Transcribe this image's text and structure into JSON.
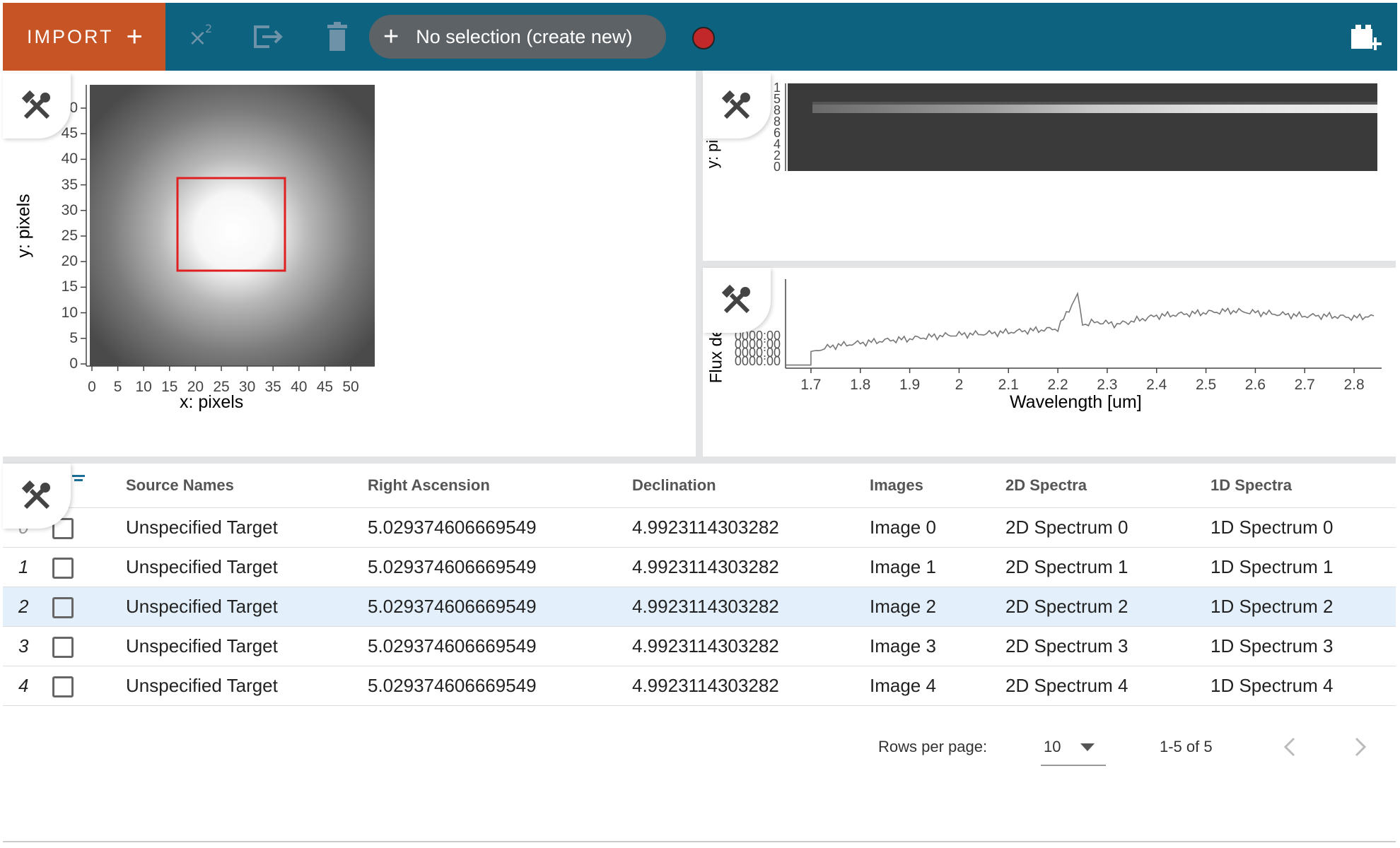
{
  "toolbar": {
    "import_label": "IMPORT",
    "import_plus": "+",
    "selection_label": "No selection (create new)",
    "selection_plus": "+",
    "chi2_icon": "x-squared-icon",
    "export_icon": "export-icon",
    "delete_icon": "trash-icon",
    "record_color": "#c0282a",
    "add_viewer_icon": "add-viewer-icon"
  },
  "colors": {
    "toolbar_bg": "#0d6280",
    "import_bg": "#c75425",
    "selection_bg": "#5d6266",
    "highlight_row": "#e3f0fb"
  },
  "image_viewer": {
    "xlabel": "x: pixels",
    "ylabel": "y: pixels",
    "x_ticks": [
      "0",
      "5",
      "10",
      "15",
      "20",
      "25",
      "30",
      "35",
      "40",
      "45",
      "50"
    ],
    "y_ticks": [
      "0",
      "5",
      "10",
      "15",
      "20",
      "25",
      "30",
      "35",
      "40",
      "45",
      "0"
    ],
    "roi_color": "#e02020"
  },
  "spectrum2d_viewer": {
    "ylabel": "y: pi",
    "y_ticks": [
      "0",
      "2",
      "4",
      "6",
      "8",
      "8",
      "5",
      "1"
    ]
  },
  "chart_data": {
    "type": "line",
    "xlabel": "Wavelength [um]",
    "ylabel": "Flux de",
    "x_ticks": [
      "1.7",
      "1.8",
      "1.9",
      "2",
      "2.1",
      "2.2",
      "2.3",
      "2.4",
      "2.5",
      "2.6",
      "2.7",
      "2.8"
    ],
    "y_ticks": [
      "0000:00",
      "0000:00",
      "0000:00",
      "0000:00"
    ],
    "xlim": [
      1.65,
      2.85
    ],
    "x": [
      1.65,
      1.7,
      1.7,
      1.75,
      1.8,
      1.85,
      1.9,
      1.95,
      2.0,
      2.05,
      2.1,
      2.15,
      2.2,
      2.24,
      2.25,
      2.28,
      2.32,
      2.36,
      2.4,
      2.45,
      2.5,
      2.55,
      2.6,
      2.65,
      2.7,
      2.75,
      2.8,
      2.84
    ],
    "y": [
      0.02,
      0.02,
      0.18,
      0.25,
      0.28,
      0.31,
      0.33,
      0.36,
      0.38,
      0.39,
      0.41,
      0.43,
      0.45,
      0.85,
      0.5,
      0.53,
      0.5,
      0.55,
      0.6,
      0.62,
      0.64,
      0.66,
      0.64,
      0.62,
      0.6,
      0.6,
      0.58,
      0.6
    ]
  },
  "table": {
    "headers": [
      "Source Names",
      "Right Ascension",
      "Declination",
      "Images",
      "2D Spectra",
      "1D Spectra"
    ],
    "rows": [
      {
        "idx": "0",
        "name": "Unspecified Target",
        "ra": "5.029374606669549",
        "dec": "4.9923114303282",
        "image": "Image 0",
        "spec2d": "2D Spectrum 0",
        "spec1d": "1D Spectrum 0"
      },
      {
        "idx": "1",
        "name": "Unspecified Target",
        "ra": "5.029374606669549",
        "dec": "4.9923114303282",
        "image": "Image 1",
        "spec2d": "2D Spectrum 1",
        "spec1d": "1D Spectrum 1"
      },
      {
        "idx": "2",
        "name": "Unspecified Target",
        "ra": "5.029374606669549",
        "dec": "4.9923114303282",
        "image": "Image 2",
        "spec2d": "2D Spectrum 2",
        "spec1d": "1D Spectrum 2"
      },
      {
        "idx": "3",
        "name": "Unspecified Target",
        "ra": "5.029374606669549",
        "dec": "4.9923114303282",
        "image": "Image 3",
        "spec2d": "2D Spectrum 3",
        "spec1d": "1D Spectrum 3"
      },
      {
        "idx": "4",
        "name": "Unspecified Target",
        "ra": "5.029374606669549",
        "dec": "4.9923114303282",
        "image": "Image 4",
        "spec2d": "2D Spectrum 4",
        "spec1d": "1D Spectrum 4"
      }
    ],
    "rows_per_page_label": "Rows per page:",
    "rows_per_page_value": "10",
    "page_range": "1-5 of 5"
  }
}
